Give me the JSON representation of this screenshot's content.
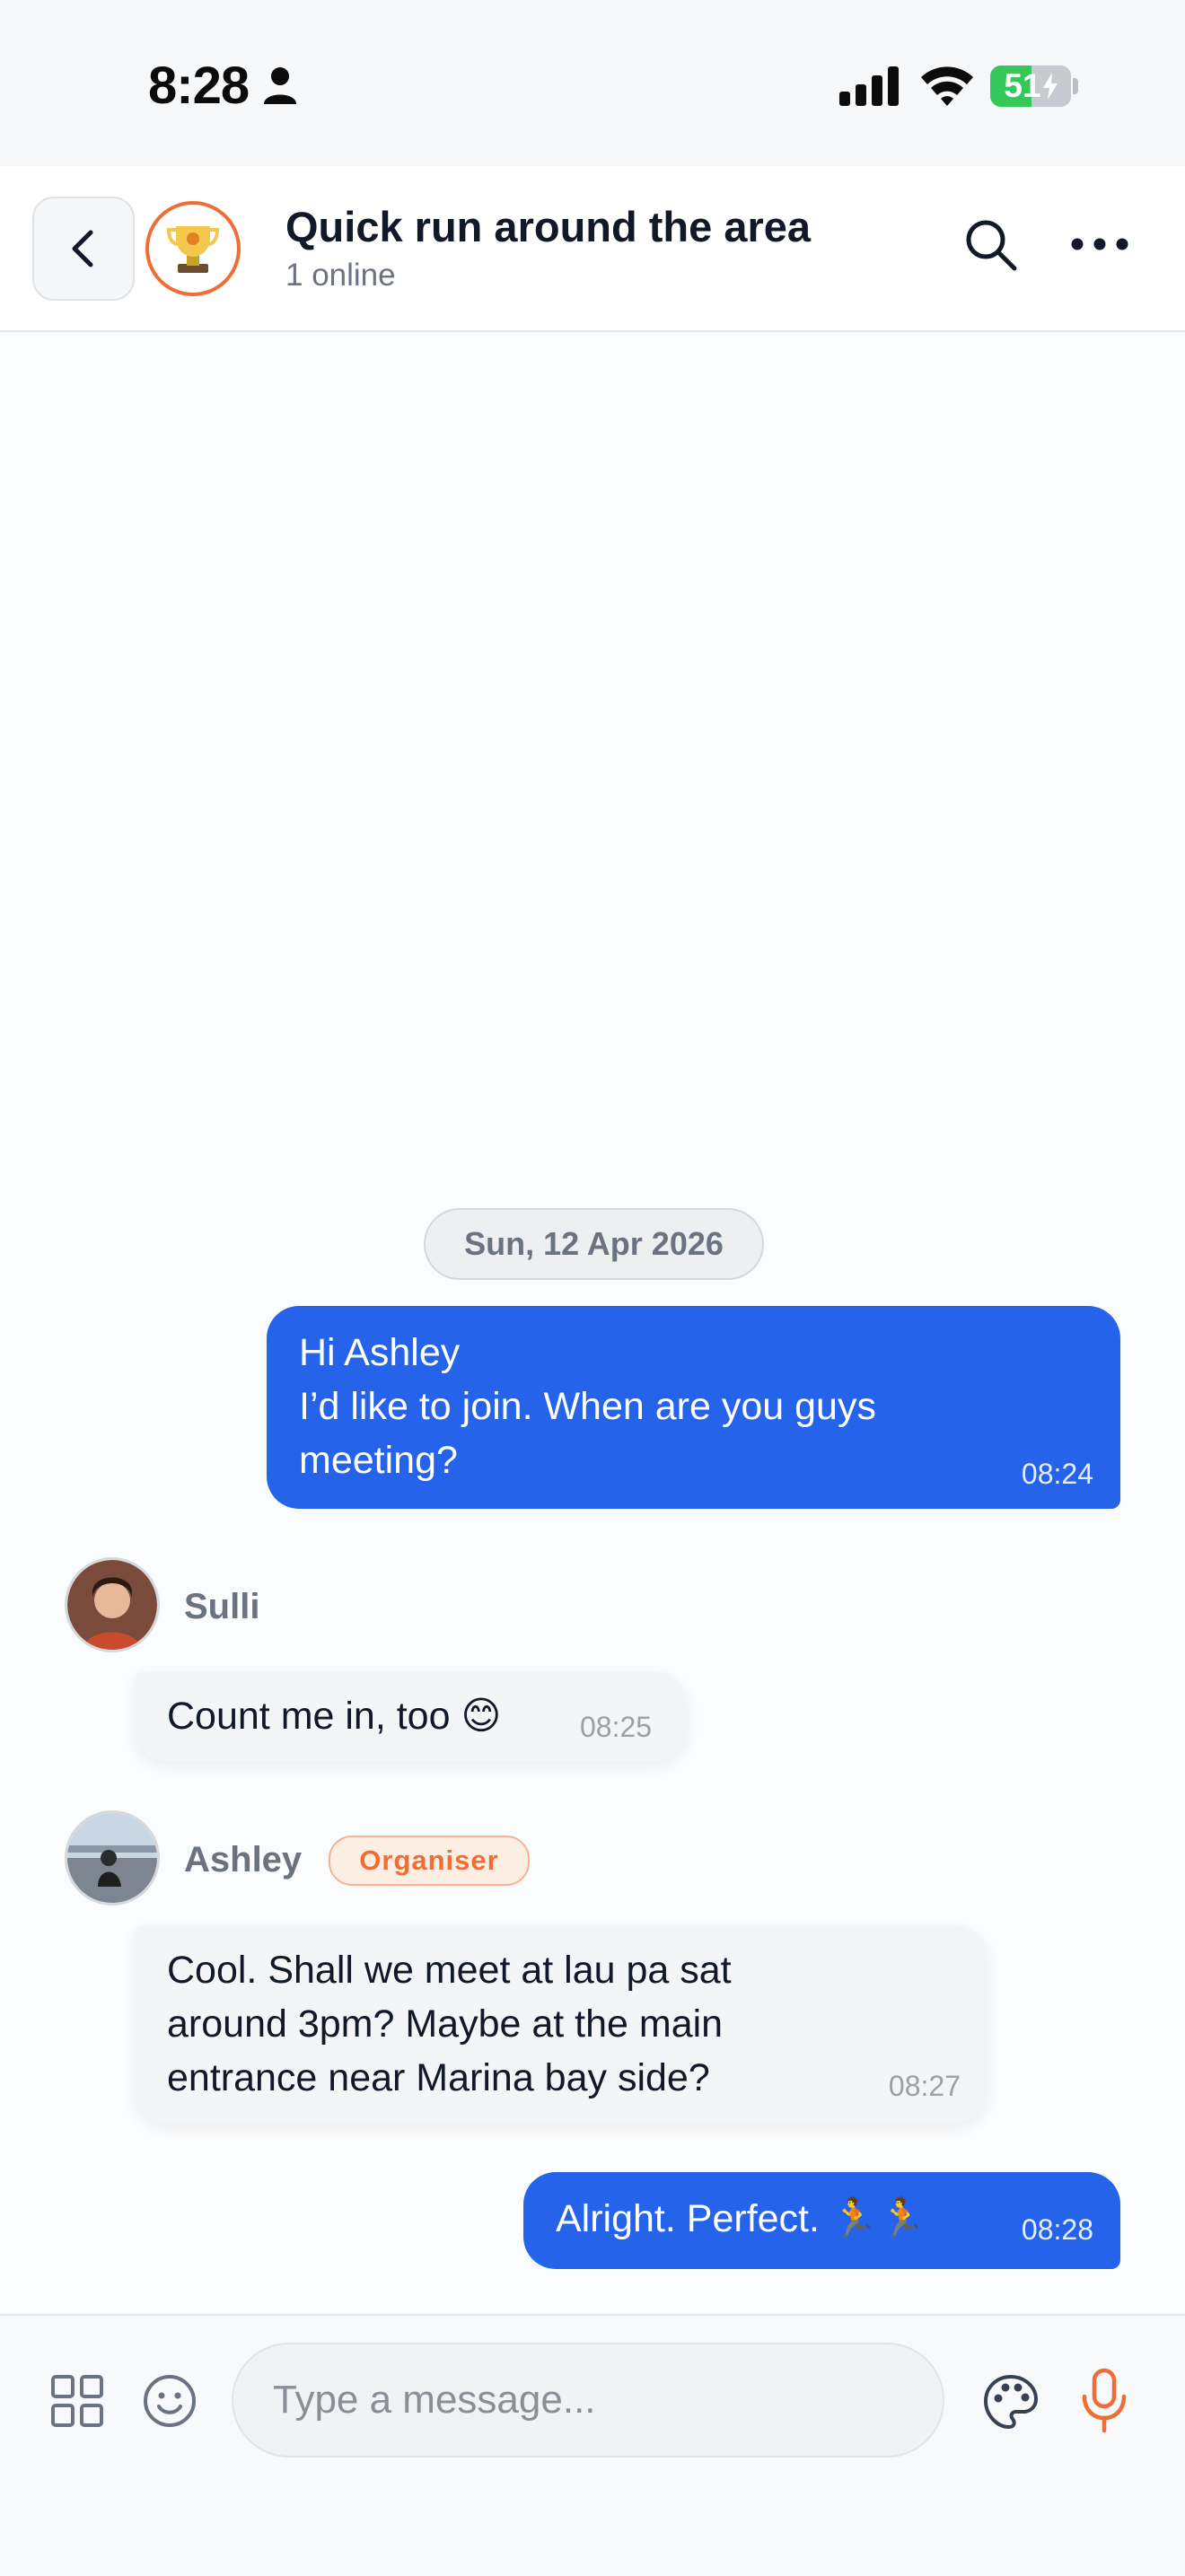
{
  "status_bar": {
    "time": "8:28",
    "battery": "51",
    "battery_level": 0.51
  },
  "header": {
    "back_icon": "chevron-left-icon",
    "group_icon": "trophy-icon",
    "title": "Quick run around the area",
    "subtitle": "1 online",
    "search_icon": "search-icon",
    "more_icon": "more-horizontal-icon"
  },
  "conversation": {
    "date_divider": "Sun, 12 Apr 2026",
    "messages": [
      {
        "direction": "outgoing",
        "text": "Hi Ashley\nI’d like to join. When are you guys meeting?",
        "time": "08:24"
      },
      {
        "direction": "incoming",
        "sender": "Sulli",
        "text": "Count me in, too 😊",
        "time": "08:25"
      },
      {
        "direction": "incoming",
        "sender": "Ashley",
        "role": "Organiser",
        "text": "Cool. Shall we meet at lau pa sat around 3pm? Maybe at the main entrance near Marina bay side?",
        "time": "08:27"
      },
      {
        "direction": "outgoing",
        "text": "Alright. Perfect. 🏃🏃",
        "time": "08:28"
      }
    ]
  },
  "composer": {
    "placeholder": "Type a message...",
    "value": "",
    "left_icons": [
      "grid-icon",
      "emoji-icon"
    ],
    "right_icons": [
      "palette-icon",
      "microphone-icon"
    ]
  },
  "colors": {
    "accent": "#2563eb",
    "brand_orange": "#f06d35",
    "battery_green": "#34c759"
  }
}
